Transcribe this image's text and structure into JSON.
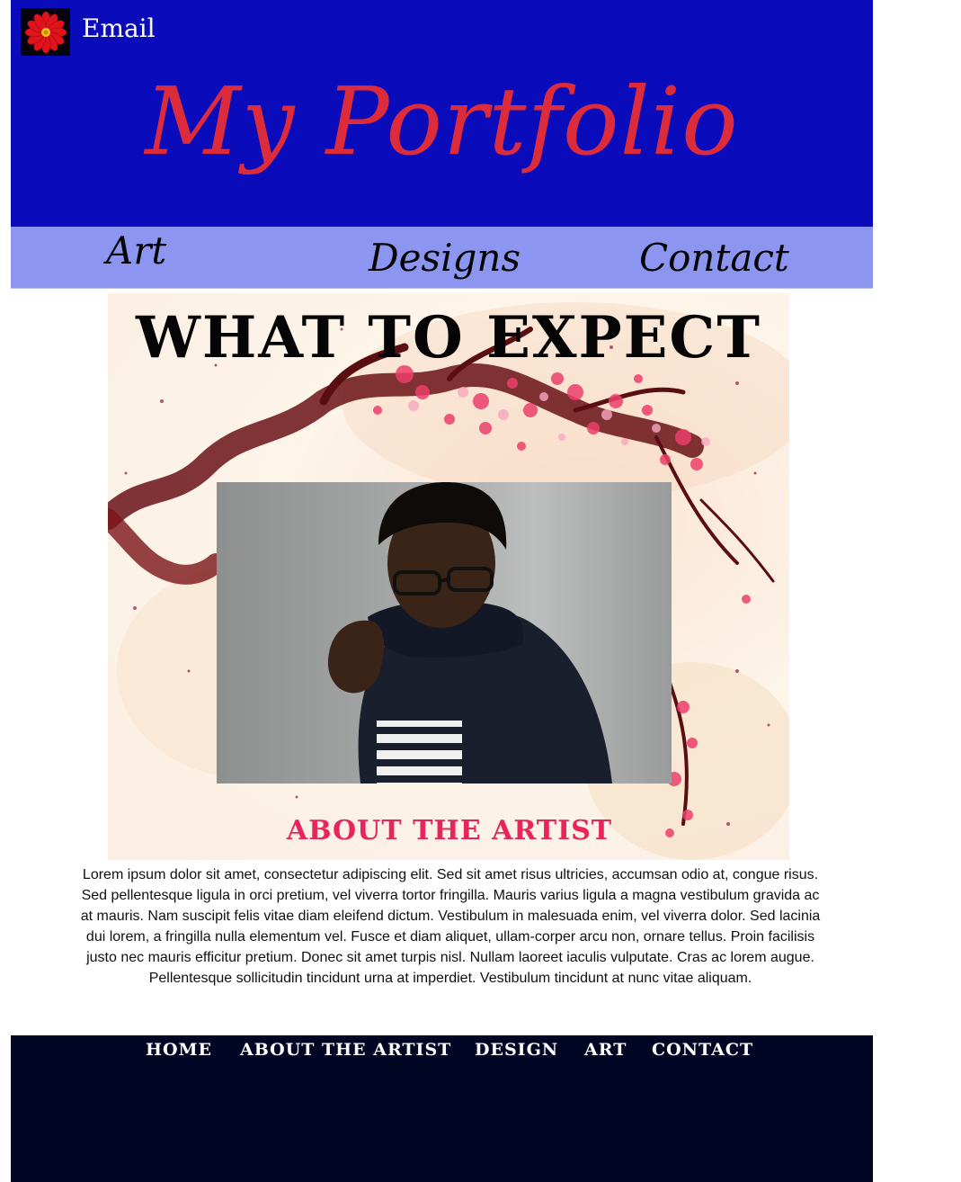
{
  "header": {
    "email_label": "Email",
    "site_title": "My Portfolio",
    "logo_icon": "red-flower-icon",
    "background_color": "#0a0cbb",
    "title_color": "#dc2c3c"
  },
  "top_nav": {
    "background_color": "#8c95f0",
    "items": [
      {
        "label": "Art"
      },
      {
        "label": "Designs"
      },
      {
        "label": "Contact"
      }
    ]
  },
  "main": {
    "heading": "WHAT TO EXPECT",
    "about_heading": "ABOUT THE ARTIST",
    "about_heading_color": "#e8245c",
    "about_text": "Lorem ipsum dolor sit amet, consectetur adipiscing elit. Sed sit amet risus ultricies, accumsan odio at, congue risus. Sed pellentesque ligula in orci pretium, vel viverra tortor fringilla. Mauris varius ligula a magna vestibulum gravida ac at mauris. Nam suscipit felis vitae diam eleifend dictum. Vestibulum in malesuada enim, vel viverra dolor. Sed lacinia dui lorem, a fringilla nulla elementum vel. Fusce et diam aliquet, ullam-corper arcu non, ornare tellus. Proin facilisis justo nec mauris efficitur pretium. Donec sit amet turpis nisl. Nullam laoreet iaculis vulputate. Cras ac lorem augue. Pellentesque sollicitudin tincidunt urna at imperdiet. Vestibulum tincidunt at nunc vitae aliquam."
  },
  "footer": {
    "background_color": "#010624",
    "items": [
      {
        "label": "HOME"
      },
      {
        "label": "ABOUT THE ARTIST"
      },
      {
        "label": "DESIGN"
      },
      {
        "label": "ART"
      },
      {
        "label": "CONTACT"
      }
    ]
  }
}
